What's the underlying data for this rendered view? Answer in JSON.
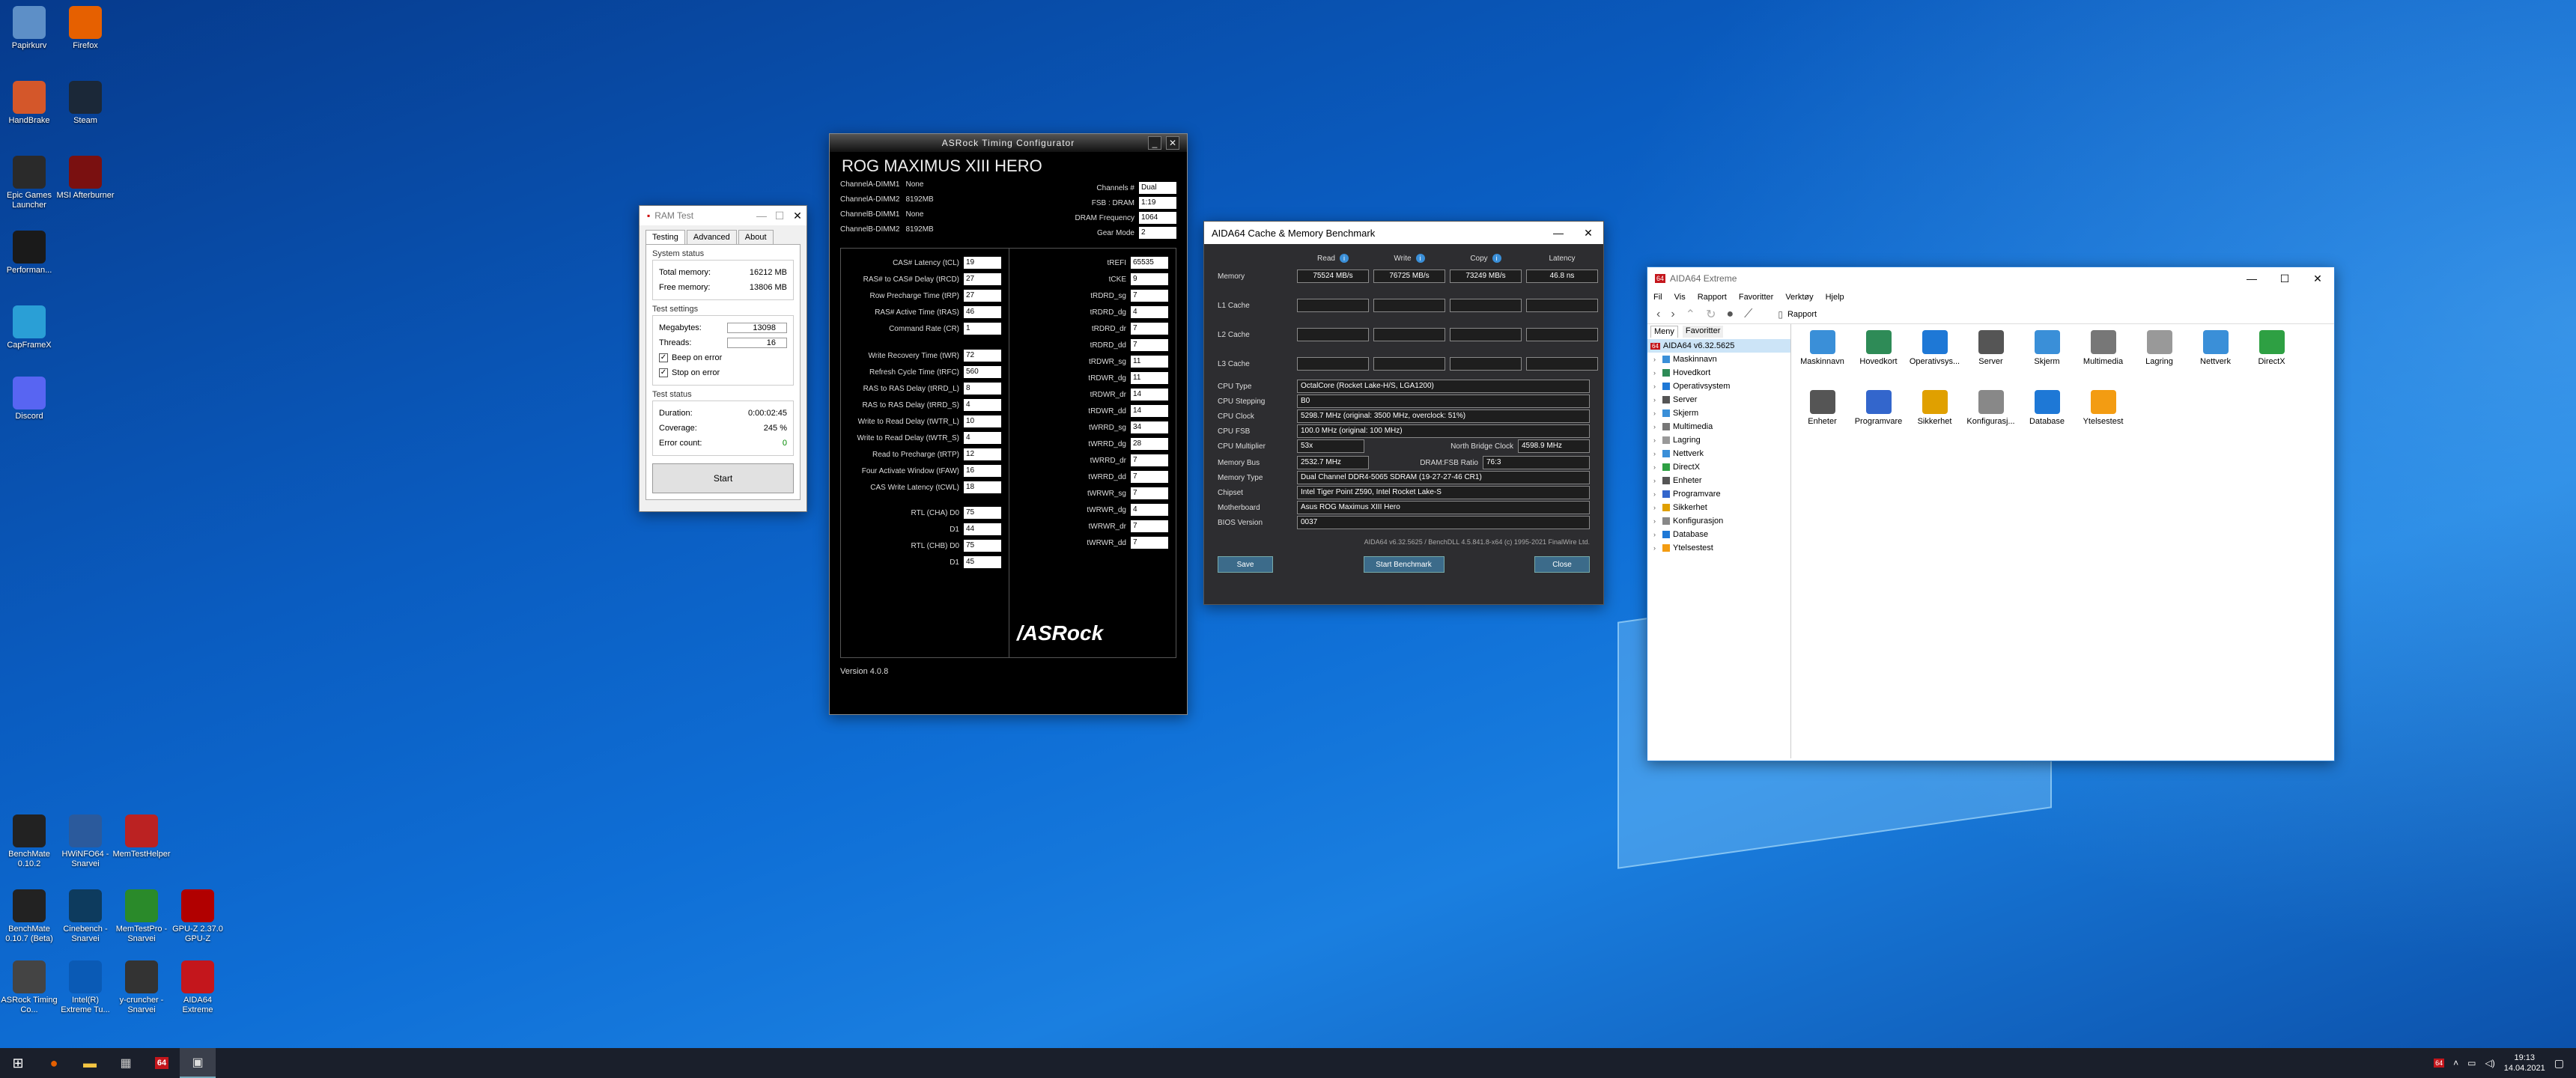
{
  "desktop_icons": [
    {
      "label": "Papirkurv",
      "icon": "recycle-bin-icon",
      "color": "#5d8fc7"
    },
    {
      "label": "Firefox",
      "icon": "firefox-icon",
      "color": "#e66000"
    },
    {
      "label": "HandBrake",
      "icon": "handbrake-icon",
      "color": "#d4572a"
    },
    {
      "label": "Steam",
      "icon": "steam-icon",
      "color": "#1b2838"
    },
    {
      "label": "Epic Games Launcher",
      "icon": "epic-icon",
      "color": "#2a2a2a"
    },
    {
      "label": "MSI Afterburner",
      "icon": "afterburner-icon",
      "color": "#7a1010"
    },
    {
      "label": "Performan...",
      "icon": "performance-icon",
      "color": "#1a1a1a"
    },
    {
      "label": "CapFrameX",
      "icon": "capframex-icon",
      "color": "#2a9fd6"
    },
    {
      "label": "Discord",
      "icon": "discord-icon",
      "color": "#5865f2"
    },
    {
      "label": "BenchMate 0.10.2",
      "icon": "benchmate-icon",
      "color": "#222"
    },
    {
      "label": "HWiNFO64 - Snarvei",
      "icon": "hwinfo-icon",
      "color": "#2b5a9c"
    },
    {
      "label": "MemTestHelper",
      "icon": "memtest-icon",
      "color": "#b22"
    },
    {
      "label": "BenchMate 0.10.7 (Beta)",
      "icon": "benchmate-beta-icon",
      "color": "#222"
    },
    {
      "label": "Cinebench - Snarvei",
      "icon": "cinebench-icon",
      "color": "#0d3b5e"
    },
    {
      "label": "MemTestPro - Snarvei",
      "icon": "memtestpro-icon",
      "color": "#2a8a2a"
    },
    {
      "label": "GPU-Z 2.37.0 GPU-Z",
      "icon": "gpuz-icon",
      "color": "#b10000"
    },
    {
      "label": "ASRock Timing Co...",
      "icon": "asrock-icon",
      "color": "#444"
    },
    {
      "label": "Intel(R) Extreme Tu...",
      "icon": "intel-xtu-icon",
      "color": "#0a5ab5"
    },
    {
      "label": "y-cruncher - Snarvei",
      "icon": "ycruncher-icon",
      "color": "#333"
    },
    {
      "label": "AIDA64 Extreme",
      "icon": "aida64-icon",
      "color": "#c4161c"
    }
  ],
  "ramtest": {
    "title": "RAM Test",
    "tabs": [
      "Testing",
      "Advanced",
      "About"
    ],
    "system_status": "System status",
    "total_memory_label": "Total memory:",
    "total_memory": "16212 MB",
    "free_memory_label": "Free memory:",
    "free_memory": "13806 MB",
    "test_settings": "Test settings",
    "megabytes_label": "Megabytes:",
    "megabytes": "13098",
    "threads_label": "Threads:",
    "threads": "16",
    "beep_label": "Beep on error",
    "stop_label": "Stop on error",
    "test_status": "Test status",
    "duration_label": "Duration:",
    "duration": "0:00:02:45",
    "coverage_label": "Coverage:",
    "coverage": "245 %",
    "errors_label": "Error count:",
    "errors": "0",
    "start": "Start"
  },
  "asrock": {
    "title": "ASRock Timing Configurator",
    "board": "ROG MAXIMUS XIII HERO",
    "dimms": [
      {
        "label": "ChannelA-DIMM1",
        "value": "None"
      },
      {
        "label": "ChannelA-DIMM2",
        "value": "8192MB"
      },
      {
        "label": "ChannelB-DIMM1",
        "value": "None"
      },
      {
        "label": "ChannelB-DIMM2",
        "value": "8192MB"
      }
    ],
    "info": [
      {
        "label": "Channels #",
        "value": "Dual"
      },
      {
        "label": "FSB : DRAM",
        "value": "1:19"
      },
      {
        "label": "DRAM Frequency",
        "value": "1064"
      },
      {
        "label": "Gear Mode",
        "value": "2"
      }
    ],
    "primary": [
      {
        "label": "CAS# Latency (tCL)",
        "value": "19"
      },
      {
        "label": "RAS# to CAS# Delay (tRCD)",
        "value": "27"
      },
      {
        "label": "Row Precharge Time (tRP)",
        "value": "27"
      },
      {
        "label": "RAS# Active Time (tRAS)",
        "value": "46"
      },
      {
        "label": "Command Rate (CR)",
        "value": "1"
      }
    ],
    "secondary": [
      {
        "label": "Write Recovery Time (tWR)",
        "value": "72"
      },
      {
        "label": "Refresh Cycle Time (tRFC)",
        "value": "560"
      },
      {
        "label": "RAS to RAS Delay (tRRD_L)",
        "value": "8"
      },
      {
        "label": "RAS to RAS Delay (tRRD_S)",
        "value": "4"
      },
      {
        "label": "Write to Read Delay (tWTR_L)",
        "value": "10"
      },
      {
        "label": "Write to Read Delay (tWTR_S)",
        "value": "4"
      },
      {
        "label": "Read to Precharge (tRTP)",
        "value": "12"
      },
      {
        "label": "Four Activate Window (tFAW)",
        "value": "16"
      },
      {
        "label": "CAS Write Latency (tCWL)",
        "value": "18"
      }
    ],
    "rtl": [
      {
        "label": "RTL (CHA) D0",
        "value": "75"
      },
      {
        "label": "D1",
        "value": "44"
      },
      {
        "label": "RTL (CHB) D0",
        "value": "75"
      },
      {
        "label": "D1",
        "value": "45"
      }
    ],
    "right": [
      {
        "label": "tREFI",
        "value": "65535"
      },
      {
        "label": "tCKE",
        "value": "9"
      },
      {
        "label": "tRDRD_sg",
        "value": "7"
      },
      {
        "label": "tRDRD_dg",
        "value": "4"
      },
      {
        "label": "tRDRD_dr",
        "value": "7"
      },
      {
        "label": "tRDRD_dd",
        "value": "7"
      },
      {
        "label": "tRDWR_sg",
        "value": "11"
      },
      {
        "label": "tRDWR_dg",
        "value": "11"
      },
      {
        "label": "tRDWR_dr",
        "value": "14"
      },
      {
        "label": "tRDWR_dd",
        "value": "14"
      },
      {
        "label": "tWRRD_sg",
        "value": "34"
      },
      {
        "label": "tWRRD_dg",
        "value": "28"
      },
      {
        "label": "tWRRD_dr",
        "value": "7"
      },
      {
        "label": "tWRRD_dd",
        "value": "7"
      },
      {
        "label": "tWRWR_sg",
        "value": "7"
      },
      {
        "label": "tWRWR_dg",
        "value": "4"
      },
      {
        "label": "tWRWR_dr",
        "value": "7"
      },
      {
        "label": "tWRWR_dd",
        "value": "7"
      }
    ],
    "logo": "/ASRock",
    "version": "Version 4.0.8"
  },
  "aidabench": {
    "title": "AIDA64 Cache & Memory Benchmark",
    "cols": [
      "Read",
      "Write",
      "Copy",
      "Latency"
    ],
    "rows": [
      {
        "label": "Memory",
        "values": [
          "75524 MB/s",
          "76725 MB/s",
          "73249 MB/s",
          "46.8 ns"
        ]
      },
      {
        "label": "L1 Cache",
        "values": [
          "",
          "",
          "",
          ""
        ]
      },
      {
        "label": "L2 Cache",
        "values": [
          "",
          "",
          "",
          ""
        ]
      },
      {
        "label": "L3 Cache",
        "values": [
          "",
          "",
          "",
          ""
        ]
      }
    ],
    "info": [
      {
        "label": "CPU Type",
        "value": "OctalCore  (Rocket Lake-H/S, LGA1200)"
      },
      {
        "label": "CPU Stepping",
        "value": "B0"
      },
      {
        "label": "CPU Clock",
        "value": "5298.7 MHz  (original: 3500 MHz, overclock: 51%)"
      },
      {
        "label": "CPU FSB",
        "value": "100.0 MHz  (original: 100 MHz)"
      },
      {
        "label": "CPU Multiplier",
        "value": "53x"
      }
    ],
    "nb_label": "North Bridge Clock",
    "nb_value": "4598.9 MHz",
    "membus_label": "Memory Bus",
    "membus_value": "2532.7 MHz",
    "ratio_label": "DRAM:FSB Ratio",
    "ratio_value": "76:3",
    "info2": [
      {
        "label": "Memory Type",
        "value": "Dual Channel DDR4-5065 SDRAM  (19-27-27-46 CR1)"
      },
      {
        "label": "Chipset",
        "value": "Intel Tiger Point Z590, Intel Rocket Lake-S"
      },
      {
        "label": "Motherboard",
        "value": "Asus ROG Maximus XIII Hero"
      },
      {
        "label": "BIOS Version",
        "value": "0037"
      }
    ],
    "footer": "AIDA64 v6.32.5625 / BenchDLL 4.5.841.8-x64  (c) 1995-2021 FinalWire Ltd.",
    "save": "Save",
    "start": "Start Benchmark",
    "close": "Close"
  },
  "aida": {
    "title": "AIDA64 Extreme",
    "menu": [
      "Fil",
      "Vis",
      "Rapport",
      "Favoritter",
      "Verktøy",
      "Hjelp"
    ],
    "report": "Rapport",
    "tabs": [
      "Meny",
      "Favoritter"
    ],
    "tree_root": "AIDA64 v6.32.5625",
    "tree": [
      "Maskinnavn",
      "Hovedkort",
      "Operativsystem",
      "Server",
      "Skjerm",
      "Multimedia",
      "Lagring",
      "Nettverk",
      "DirectX",
      "Enheter",
      "Programvare",
      "Sikkerhet",
      "Konfigurasjon",
      "Database",
      "Ytelsestest"
    ],
    "icons": [
      {
        "label": "Maskinnavn",
        "icon": "computer-icon",
        "color": "#3a8fd8"
      },
      {
        "label": "Hovedkort",
        "icon": "motherboard-icon",
        "color": "#2e8b57"
      },
      {
        "label": "Operativsys...",
        "icon": "windows-icon",
        "color": "#1e78d6"
      },
      {
        "label": "Server",
        "icon": "server-icon",
        "color": "#555"
      },
      {
        "label": "Skjerm",
        "icon": "monitor-icon",
        "color": "#3a8fd8"
      },
      {
        "label": "Multimedia",
        "icon": "multimedia-icon",
        "color": "#777"
      },
      {
        "label": "Lagring",
        "icon": "storage-icon",
        "color": "#999"
      },
      {
        "label": "Nettverk",
        "icon": "network-icon",
        "color": "#3a8fd8"
      },
      {
        "label": "DirectX",
        "icon": "directx-icon",
        "color": "#2ea043"
      },
      {
        "label": "Enheter",
        "icon": "devices-icon",
        "color": "#555"
      },
      {
        "label": "Programvare",
        "icon": "software-icon",
        "color": "#3366cc"
      },
      {
        "label": "Sikkerhet",
        "icon": "security-icon",
        "color": "#e0a000"
      },
      {
        "label": "Konfigurasj...",
        "icon": "config-icon",
        "color": "#888"
      },
      {
        "label": "Database",
        "icon": "database-icon",
        "color": "#1e78d6"
      },
      {
        "label": "Ytelsestest",
        "icon": "benchmark-icon",
        "color": "#f39c12"
      }
    ]
  },
  "taskbar": {
    "time": "19:13",
    "date": "14.04.2021"
  }
}
